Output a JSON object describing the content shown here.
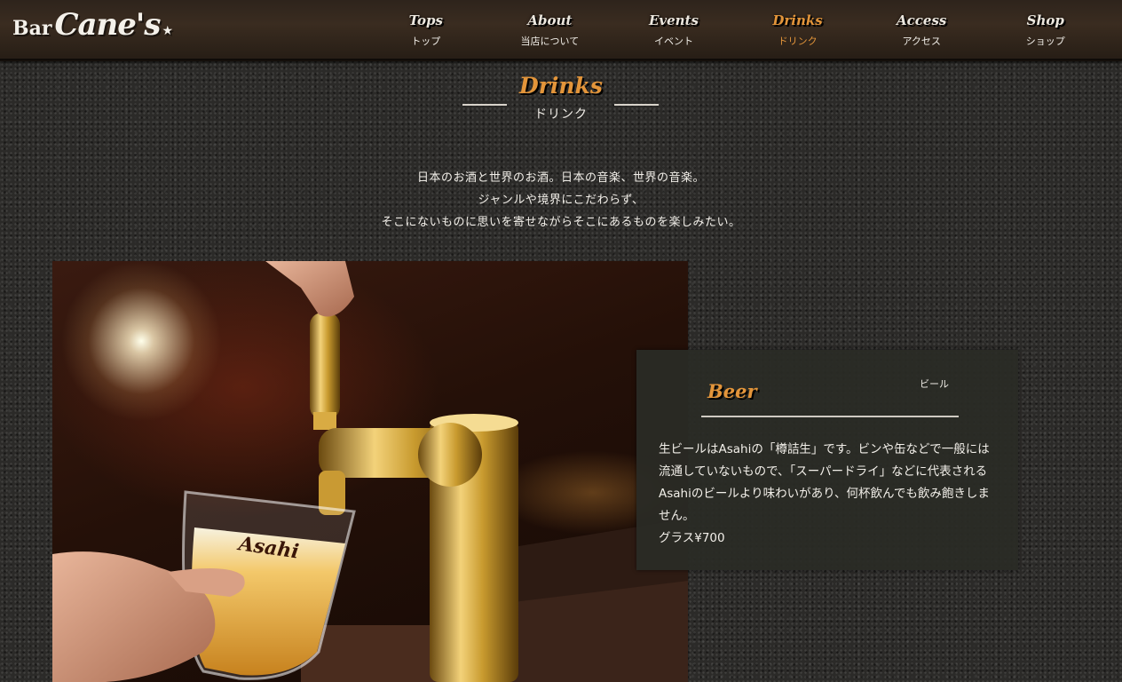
{
  "logo": {
    "bar": "Bar",
    "canes": "Cane's",
    "star": "★"
  },
  "nav": [
    {
      "en": "Tops",
      "ja": "トップ"
    },
    {
      "en": "About",
      "ja": "当店について"
    },
    {
      "en": "Events",
      "ja": "イベント"
    },
    {
      "en": "Drinks",
      "ja": "ドリンク"
    },
    {
      "en": "Access",
      "ja": "アクセス"
    },
    {
      "en": "Shop",
      "ja": "ショップ"
    }
  ],
  "nav_active": "Drinks",
  "section": {
    "title_en": "Drinks",
    "title_ja": "ドリンク"
  },
  "intro": [
    "日本のお酒と世界のお酒。日本の音楽、世界の音楽。",
    "ジャンルや境界にこだわらず、",
    "そこにないものに思いを寄せながらそこにあるものを楽しみたい。"
  ],
  "photo": {
    "glass_brand": "Asahi"
  },
  "beer": {
    "title_en": "Beer",
    "title_ja": "ビール",
    "description": "生ビールはAsahiの「樽詰生」です。ビンや缶などで一般には流通していないもので、「スーパードライ」などに代表されるAsahiのビールより味わいがあり、何杯飲んでも飲み飽きしません。",
    "price": "グラス¥700"
  },
  "colors": {
    "accent": "#e3953a",
    "header_bg": "#2e241c",
    "page_bg": "#2b2a28",
    "card_bg": "#2a2b26"
  },
  "icons": {
    "logo_star": "star-icon"
  }
}
